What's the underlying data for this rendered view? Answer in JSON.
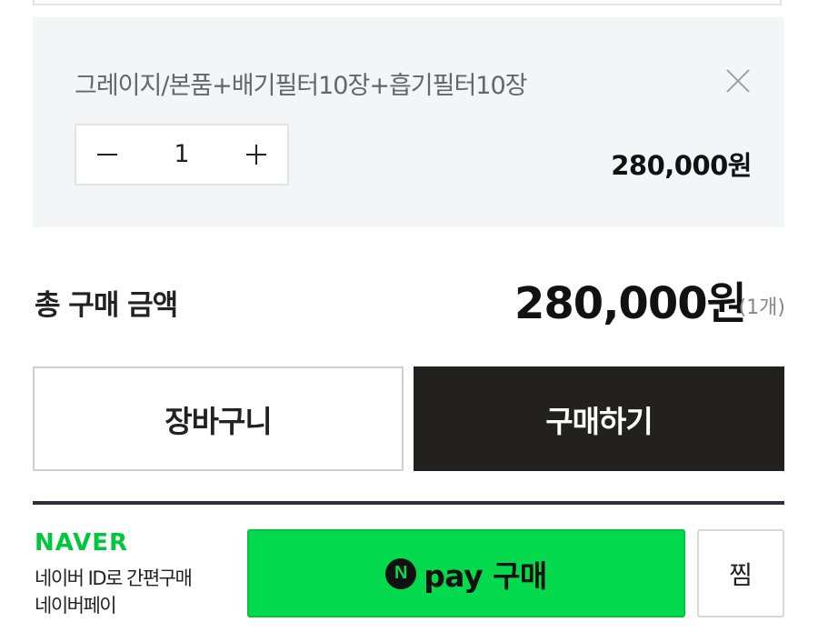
{
  "option": {
    "name": "그레이지/본품+배기필터10장+흡기필터10장",
    "quantity": "1",
    "price": "280,000원"
  },
  "total": {
    "label": "총 구매 금액",
    "price": "280,000원",
    "count": "(1개)"
  },
  "actions": {
    "cart_label": "장바구니",
    "buy_label": "구매하기"
  },
  "naver": {
    "logo": "NAVER",
    "desc_line1": "네이버 ID로 간편구매",
    "desc_line2": "네이버페이",
    "npay_icon": "N",
    "npay_label": "pay 구매",
    "wish_label": "찜"
  },
  "colors": {
    "panel_bg": "#f4f5f7",
    "buy_bg": "#23211d",
    "naver_green": "#00c73c",
    "npay_bg": "#03da4d"
  },
  "icons": [
    "close-icon",
    "minus-icon",
    "plus-icon",
    "naver-n-icon"
  ]
}
